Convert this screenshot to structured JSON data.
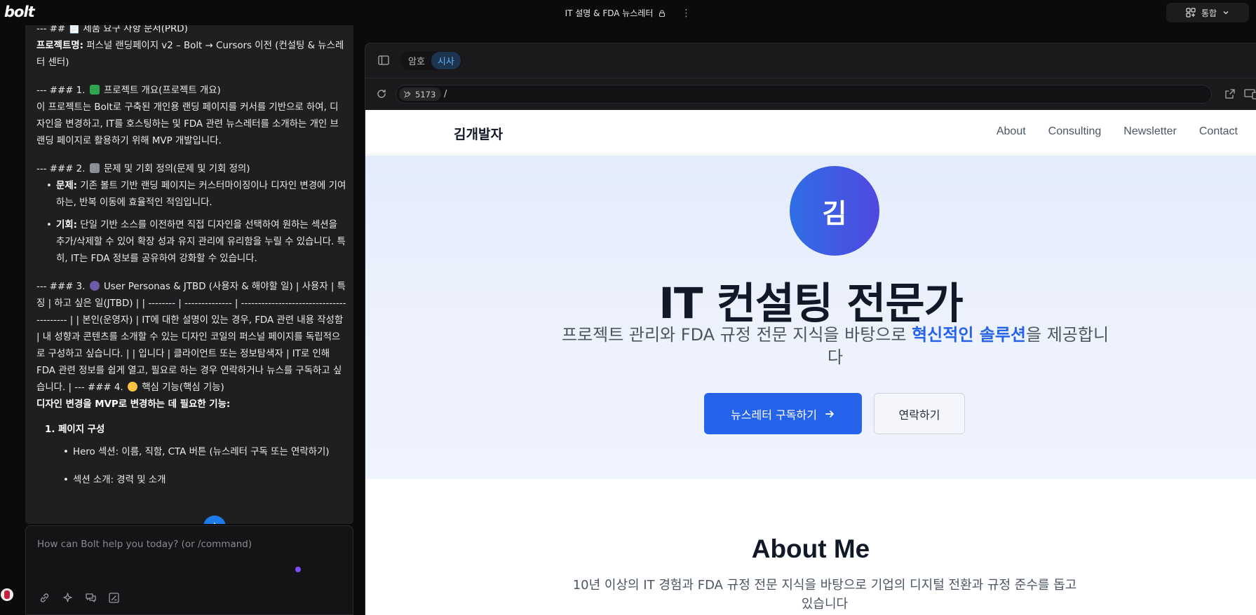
{
  "app": {
    "logo": "bolt"
  },
  "header": {
    "project_title": "IT 설명 & FDA 뉴스레터",
    "integrate_label": "통합"
  },
  "chat": {
    "heading_cut": "--- ## 📄 제품 요구 사항 문서(PRD)",
    "project_label": "프로젝트명:",
    "project_name": "퍼스널 랜딩페이지 v2 – Bolt → Cursors 이전 (컨설팅 & 뉴스레터 센터)",
    "s1_heading_pre": "--- ### 1.",
    "s1_heading_post": "프로젝트 개요(프로젝트 개요)",
    "s1_body": "이 프로젝트는 Bolt로 구축된 개인용 랜딩 페이지를 커서를 기반으로 하여, 디자인을 변경하고, IT를 호스팅하는 및 FDA 관련 뉴스레터를 소개하는 개인 브랜딩 페이지로 활용하기 위해 MVP 개발입니다.",
    "s2_heading_pre": "--- ### 2.",
    "s2_heading_post": "문제 및 기회 정의(문제 및 기회 정의)",
    "s2_items": [
      {
        "label": "문제:",
        "text": "기존 볼트 기반 랜딩 페이지는 커스터마이징이나 디자인 변경에 기여하는, 반복 이동에 효율적인 적임입니다."
      },
      {
        "label": "기회:",
        "text": "단일 기반 소스를 이전하면 직접 디자인을 선택하여 원하는 섹션을 추가/삭제할 수 있어 확장 성과 유지 관리에 유리함을 누릴 수 있습니다. 특히, IT는 FDA 정보를 공유하여 강화할 수 있습니다."
      }
    ],
    "s3_pre": "--- ### 3.",
    "s3_body": "User Personas & JTBD (사용자 & 해야할 일) | 사용자 | 특징 | 하고 싶은 일(JTBD) | | -------- | -------------- | ---------------------------------------- | | 본인(운영자) | IT에 대한 설명이 있는 경우, FDA 관련 내용 작성함 | 내 성향과 콘텐츠를 소개할 수 있는 디자인 코일의 퍼스널 페이지를 독립적으로 구성하고 싶습니다. | | 입니다 | 클라이언트 또는 정보탐색자 | IT로 인해 FDA 관련 정보를 쉽게 열고, 필요로 하는 경우 연락하거나 뉴스를 구독하고 싶습니다. | --- ### 4.",
    "s4_post": "핵심 기능(핵심 기능)",
    "mvp_line": "디자인 변경을 MVP로 변경하는 데 필요한 기능:",
    "list1_label": "1. 페이지 구성",
    "sub_items": [
      "Hero 섹션: 이름, 직함, CTA 버튼 (뉴스레터 구독 또는 연락하기)",
      "섹션 소개: 경력 및 소개"
    ]
  },
  "prompt": {
    "placeholder": "How can Bolt help you today? (or /command)"
  },
  "preview": {
    "tabs": [
      "암호",
      "시사"
    ],
    "active_tab": "시사",
    "port": "5173",
    "path": "/"
  },
  "site": {
    "brand": "김개발자",
    "nav": [
      "About",
      "Consulting",
      "Newsletter",
      "Contact"
    ],
    "avatar_initial": "김",
    "hero_title": "IT 컨설팅 전문가",
    "hero_sub_pre": "프로젝트 관리와 FDA 규정 전문 지식을 바탕으로 ",
    "hero_sub_hl": "혁신적인 솔루션",
    "hero_sub_post": "을 제공합니다",
    "cta_primary": "뉴스레터 구독하기",
    "cta_secondary": "연락하기",
    "about_title": "About Me",
    "about_desc": "10년 이상의 IT 경험과 FDA 규정 전문 지식을 바탕으로 기업의 디지털 전환과 규정 준수를 돕고 있습니다"
  },
  "colors": {
    "accent": "#2563eb",
    "chat_bg": "#1f1f22",
    "app_bg": "#0b0b0c",
    "active_tab": "#5fb3ff"
  }
}
